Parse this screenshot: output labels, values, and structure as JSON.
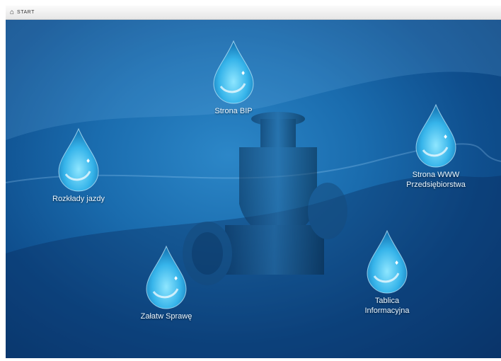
{
  "window": {
    "title": "START",
    "home_icon": "home-icon"
  },
  "tiles": [
    {
      "id": "strona-bip",
      "label": "Strona BIP",
      "icon": "water-drop-icon"
    },
    {
      "id": "rozklady-jazdy",
      "label": "Rozkłady jazdy",
      "icon": "water-drop-icon"
    },
    {
      "id": "strona-www",
      "label": "Strona WWW\nPrzedsiębiorstwa",
      "icon": "water-drop-icon"
    },
    {
      "id": "zalatw-sprawe",
      "label": "Załatw Sprawę",
      "icon": "water-drop-icon"
    },
    {
      "id": "tablica-informacyjna",
      "label": "Tablica\nInformacyjna",
      "icon": "water-drop-icon"
    }
  ],
  "colors": {
    "background_deep": "#0a3b73",
    "background_light": "#2c87c8",
    "drop": "#5fd0ff"
  }
}
